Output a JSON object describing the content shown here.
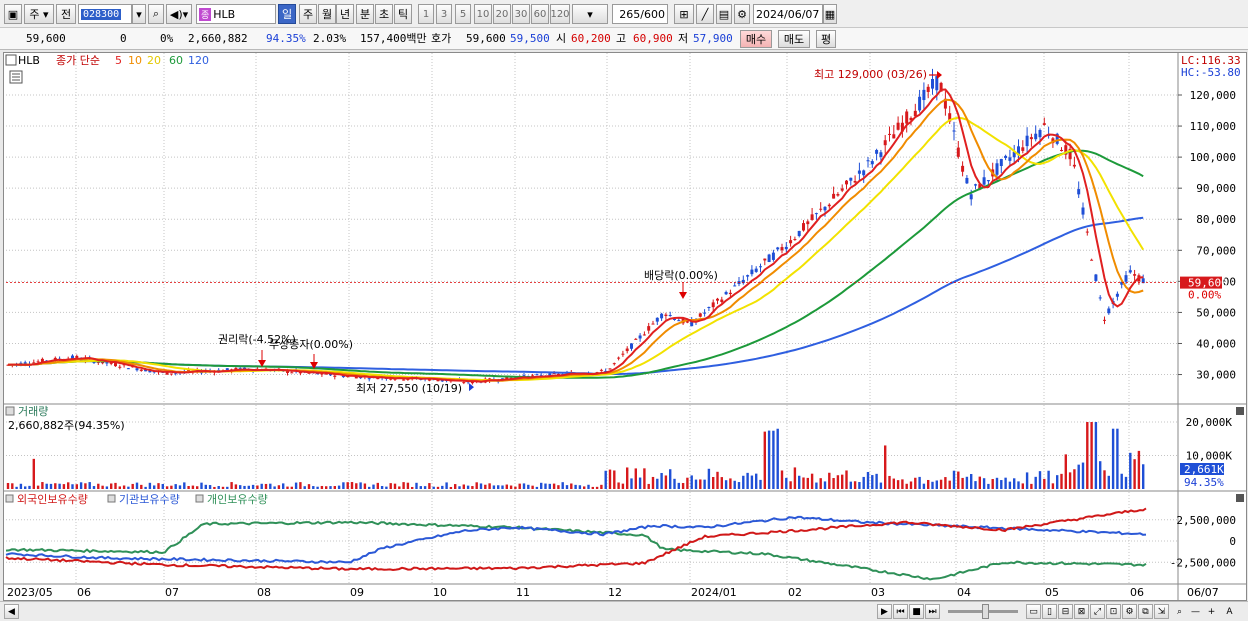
{
  "toolbar": {
    "type_label": "주",
    "prev_label": "전",
    "code": "028300",
    "badge": "종",
    "name": "HLB",
    "periods": [
      "일",
      "주",
      "월",
      "년",
      "분",
      "초",
      "틱"
    ],
    "period_active": "일",
    "intervals": [
      "1",
      "3",
      "5",
      "10",
      "20",
      "30",
      "60",
      "120"
    ],
    "count_value": "265",
    "count_max": "/600",
    "date": "2024/06/07"
  },
  "quote": {
    "price": "59,600",
    "change": "0",
    "change_pct": "0%",
    "volume": "2,660,882",
    "volume_ratio": "94.35%",
    "turnover_pct": "2.03%",
    "amount": "157,400백만",
    "hoga_label": "호가",
    "ask": "59,600",
    "bid": "59,500",
    "open_label": "시",
    "open": "60,200",
    "high_label": "고",
    "high": "60,900",
    "low_label": "저",
    "low": "57,900",
    "buy_label": "매수",
    "sell_label": "매도",
    "eval_label": "평"
  },
  "colors": {
    "up": "#d7191c",
    "down": "#1f4fd6",
    "ma5": "#e02020",
    "ma10": "#f08c00",
    "ma20": "#f2e200",
    "ma60": "#1d9a3a",
    "ma120": "#2f5fe0",
    "foreign": "#d01818",
    "institution": "#2b58d6",
    "individual": "#2f9058"
  },
  "legend": {
    "symbol": "HLB",
    "title": "종가 단순",
    "ma": [
      {
        "label": "5",
        "color": "#e02020"
      },
      {
        "label": "10",
        "color": "#f08c00"
      },
      {
        "label": "20",
        "color": "#e3c800"
      },
      {
        "label": "60",
        "color": "#1d9a3a"
      },
      {
        "label": "120",
        "color": "#2f5fe0"
      }
    ]
  },
  "right_info": {
    "lc": "LC:116.33",
    "hc": "HC:-53.80"
  },
  "annotations": {
    "high": "최고 129,000 (03/26)",
    "low": "최저 27,550 (10/19)",
    "rights": "권리락(-4.52%)",
    "bonus": "무상증자(0.00%)",
    "dividend": "배당락(0.00%)"
  },
  "price_panel": {
    "current_label": "59,600",
    "current_pct": "0.00%",
    "axis_labels": [
      "120,000",
      "110,000",
      "100,000",
      "90,000",
      "80,000",
      "70,000",
      "60,000",
      "50,000",
      "40,000",
      "30,000"
    ]
  },
  "volume_panel": {
    "title": "거래량",
    "info": "2,660,882주(94.35%)",
    "axis_labels": [
      "20,000K",
      "10,000K"
    ],
    "current_label": "2,661K",
    "current_pct": "94.35%"
  },
  "holdings_panel": {
    "series_labels": [
      "외국인보유수량",
      "기관보유수량",
      "개인보유수량"
    ],
    "axis_labels": [
      "2,500,000",
      "0",
      "-2,500,000"
    ]
  },
  "time_axis": [
    "2023/05",
    "06",
    "07",
    "08",
    "09",
    "10",
    "11",
    "12",
    "2024/01",
    "02",
    "03",
    "04",
    "05",
    "06",
    "06/07"
  ],
  "chart_data": {
    "type": "candlestick",
    "x_range": [
      "2023/05",
      "2024/06/07"
    ],
    "y_range": [
      27550,
      129000
    ],
    "anchors": [
      {
        "x": "2023/05",
        "close": 33000
      },
      {
        "x": "2023/06",
        "close": 35500
      },
      {
        "x": "2023/07",
        "close": 30500
      },
      {
        "x": "2023/08",
        "close": 31800
      },
      {
        "x": "2023/09",
        "close": 29500
      },
      {
        "x": "2023/10",
        "close": 28500
      },
      {
        "x": "2023/10/19",
        "close": 27550
      },
      {
        "x": "2023/11",
        "close": 29000
      },
      {
        "x": "2023/12",
        "close": 31000
      },
      {
        "x": "2023/12 late",
        "close": 50000
      },
      {
        "x": "2024/01",
        "close": 46000
      },
      {
        "x": "2024/02",
        "close": 72000
      },
      {
        "x": "2024/03",
        "close": 98000
      },
      {
        "x": "2024/03/26",
        "close": 125000
      },
      {
        "x": "2024/04",
        "close": 88000
      },
      {
        "x": "2024/04 mid",
        "close": 110000
      },
      {
        "x": "2024/05",
        "close": 100000
      },
      {
        "x": "2024/05 late",
        "close": 48000
      },
      {
        "x": "2024/06",
        "close": 63000
      },
      {
        "x": "2024/06/07",
        "close": 59600
      }
    ]
  }
}
